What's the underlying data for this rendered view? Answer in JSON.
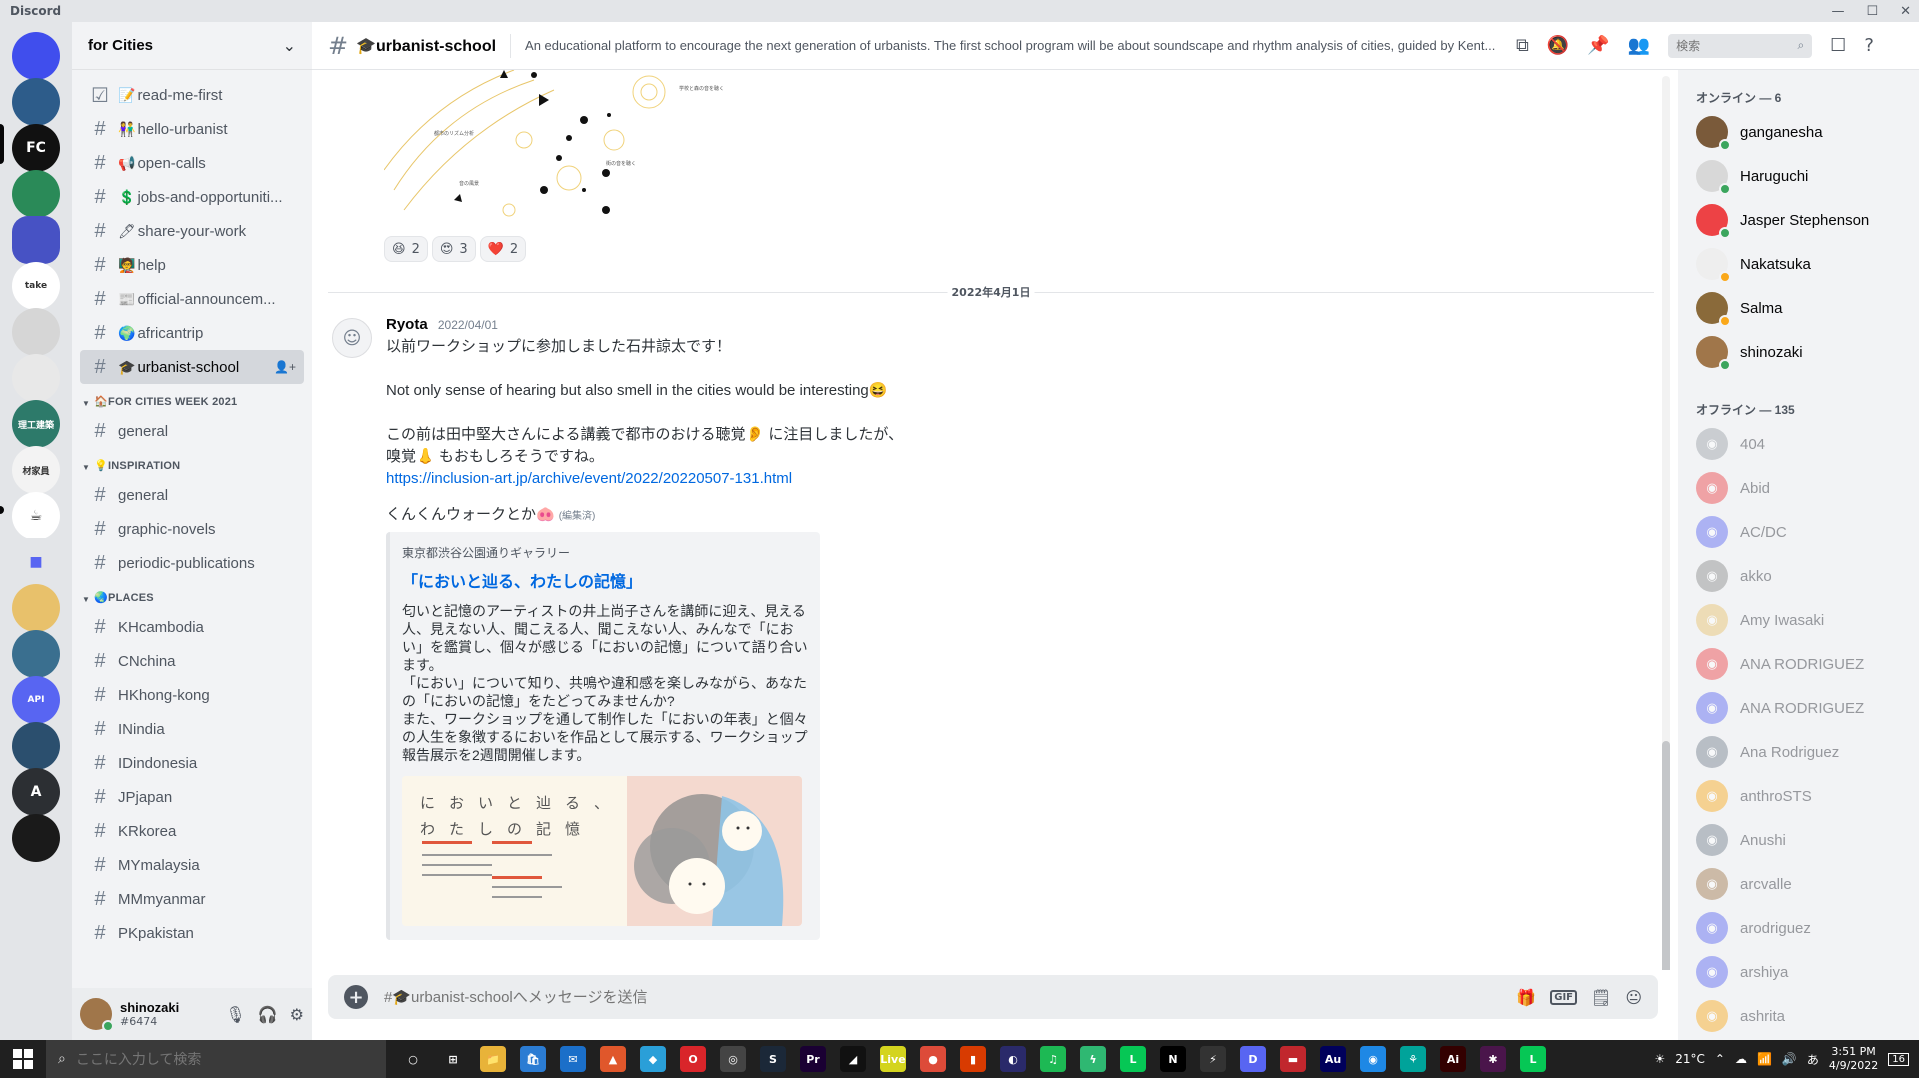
{
  "app": {
    "title": "Discord"
  },
  "servers": [
    {
      "name": "discord-home",
      "color": "#404eed",
      "label": ""
    },
    {
      "name": "server-2",
      "color": "#2d5c8a",
      "label": ""
    },
    {
      "name": "server-fc",
      "color": "#111111",
      "label": "FC"
    },
    {
      "name": "server-4",
      "color": "#2a8a58",
      "label": ""
    },
    {
      "name": "server-school",
      "color": "#4752c4",
      "label": ""
    },
    {
      "name": "server-take",
      "color": "#ffffff",
      "label": "take"
    },
    {
      "name": "server-7",
      "color": "#d6d6d6",
      "label": ""
    },
    {
      "name": "server-8",
      "color": "#e8e8e8",
      "label": ""
    },
    {
      "name": "server-rikou",
      "color": "#2d7a6a",
      "label": "理工建築"
    },
    {
      "name": "server-10",
      "color": "#f3f3f3",
      "label": "材家員"
    },
    {
      "name": "server-coffee",
      "color": "#ffffff",
      "label": "☕"
    },
    {
      "name": "server-folder",
      "color": "#e3e5e8",
      "label": "■"
    },
    {
      "name": "server-13",
      "color": "#e8c16b",
      "label": ""
    },
    {
      "name": "server-14",
      "color": "#3a6f8f",
      "label": ""
    },
    {
      "name": "server-api",
      "color": "#5865f2",
      "label": "API"
    },
    {
      "name": "server-python",
      "color": "#2b4f6e",
      "label": ""
    },
    {
      "name": "server-17",
      "color": "#2c2f33",
      "label": "A"
    },
    {
      "name": "server-obs",
      "color": "#1a1a1a",
      "label": ""
    }
  ],
  "guild": {
    "name": "for Cities"
  },
  "channels_top": [
    {
      "emoji": "📝",
      "label": "read-me-first",
      "kind": "rules"
    },
    {
      "emoji": "👫",
      "label": "hello-urbanist"
    },
    {
      "emoji": "📢",
      "label": "open-calls"
    },
    {
      "emoji": "💲",
      "label": "jobs-and-opportuniti..."
    },
    {
      "emoji": "🖊",
      "label": "share-your-work"
    },
    {
      "emoji": "🧑‍🏫",
      "label": "help"
    },
    {
      "emoji": "📰",
      "label": "official-announcem..."
    },
    {
      "emoji": "🌍",
      "label": "africantrip"
    },
    {
      "emoji": "🎓",
      "label": "urbanist-school",
      "active": true
    }
  ],
  "categories": [
    {
      "emoji": "🏠",
      "label": "FOR CITIES WEEK 2021",
      "channels": [
        {
          "label": "general"
        }
      ]
    },
    {
      "emoji": "💡",
      "label": "INSPIRATION",
      "channels": [
        {
          "label": "general"
        },
        {
          "label": "graphic-novels"
        },
        {
          "label": "periodic-publications"
        }
      ]
    },
    {
      "emoji": "🌏",
      "label": "PLACES",
      "channels": [
        {
          "label": "KHcambodia"
        },
        {
          "label": "CNchina"
        },
        {
          "label": "HKhong-kong"
        },
        {
          "label": "INindia"
        },
        {
          "label": "IDindonesia"
        },
        {
          "label": "JPjapan"
        },
        {
          "label": "KRkorea"
        },
        {
          "label": "MYmalaysia"
        },
        {
          "label": "MMmyanmar"
        },
        {
          "label": "PKpakistan"
        }
      ]
    }
  ],
  "user_panel": {
    "username": "shinozaki",
    "tag": "#6474"
  },
  "chat_header": {
    "channel": "🎓urbanist-school",
    "topic": "An educational platform to encourage the next generation of urbanists. The first school program will be about soundscape and rhythm analysis of cities, guided by Kent...",
    "search_placeholder": "検索"
  },
  "reactions": [
    {
      "emoji": "😆",
      "count": "2"
    },
    {
      "emoji": "😍",
      "count": "3"
    },
    {
      "emoji": "❤️",
      "count": "2"
    }
  ],
  "date_divider": "2022年4月1日",
  "message": {
    "author": "Ryota",
    "timestamp": "2022/04/01",
    "line1": "以前ワークショップに参加しました石井諒太です！",
    "line2": "Not only sense of hearing but also smell in the cities would be interesting😆",
    "line3": "この前は田中堅大さんによる講義で都市のおける聴覚👂 に注目しましたが、",
    "line4": "嗅覚👃 もおもしろそうですね。",
    "link": "https://inclusion-art.jp/archive/event/2022/20220507-131.html",
    "line5": "くんくんウォークとか🐽",
    "edited": "(編集済)"
  },
  "embed": {
    "provider": "東京都渋谷公園通りギャラリー",
    "title": "「においと辿る、わたしの記憶」",
    "description": "匂いと記憶のアーティストの井上尚子さんを講師に迎え、見える人、見えない人、聞こえる人、聞こえない人、みんなで「におい」を鑑賞し、個々が感じる「においの記憶」について語り合います。\n「におい」について知り、共鳴や違和感を楽しみながら、あなたの「においの記憶」をたどってみませんか?\nまた、ワークショップを通して制作した「においの年表」と個々の人生を象徴するにおいを作品として展示する、ワークショップ報告展示を2週間開催します。",
    "image_title": "においと辿る、わたしの記憶"
  },
  "composer": {
    "placeholder": "#🎓urbanist-schoolへメッセージを送信"
  },
  "members": {
    "online_header": "オンライン — 6",
    "online": [
      {
        "name": "ganganesha",
        "color": "#7a5a3a",
        "status": "#3ba55d"
      },
      {
        "name": "Haruguchi",
        "color": "#d8d8d8",
        "status": "#3ba55d"
      },
      {
        "name": "Jasper Stephenson",
        "color": "#ed4245",
        "status": "#3ba55d"
      },
      {
        "name": "Nakatsuka",
        "color": "#eeeeee",
        "status": "#faa81a"
      },
      {
        "name": "Salma",
        "color": "#8a6a3a",
        "status": "#faa81a"
      },
      {
        "name": "shinozaki",
        "color": "#a0764a",
        "status": "#3ba55d"
      }
    ],
    "offline_header": "オフライン — 135",
    "offline": [
      {
        "name": "404",
        "color": "#9aa0a6"
      },
      {
        "name": "Abid",
        "color": "#ed4245"
      },
      {
        "name": "AC/DC",
        "color": "#5865f2"
      },
      {
        "name": "akko",
        "color": "#8a8a8a"
      },
      {
        "name": "Amy Iwasaki",
        "color": "#e8c16b"
      },
      {
        "name": "ANA RODRIGUEZ",
        "color": "#ed4245"
      },
      {
        "name": "ANA RODRIGUEZ",
        "color": "#5865f2"
      },
      {
        "name": "Ana Rodriguez",
        "color": "#747f8d"
      },
      {
        "name": "anthroSTS",
        "color": "#faa81a"
      },
      {
        "name": "Anushi",
        "color": "#747f8d"
      },
      {
        "name": "arcvalle",
        "color": "#a0764a"
      },
      {
        "name": "arodriguez",
        "color": "#5865f2"
      },
      {
        "name": "arshiya",
        "color": "#5865f2"
      },
      {
        "name": "ashrita",
        "color": "#faa81a"
      }
    ]
  },
  "taskbar": {
    "search_placeholder": "ここに入力して検索",
    "apps": [
      {
        "label": "○",
        "color": "transparent"
      },
      {
        "label": "⊞",
        "color": "transparent"
      },
      {
        "label": "📁",
        "color": "#e8b339"
      },
      {
        "label": "🛍",
        "color": "#2b7cd3"
      },
      {
        "label": "✉",
        "color": "#1b6fc9"
      },
      {
        "label": "▲",
        "color": "#e0572b"
      },
      {
        "label": "◆",
        "color": "#2a9fd8"
      },
      {
        "label": "O",
        "color": "#d9252a"
      },
      {
        "label": "◎",
        "color": "#444"
      },
      {
        "label": "S",
        "color": "#1b2838"
      },
      {
        "label": "Pr",
        "color": "#1a0033"
      },
      {
        "label": "◢",
        "color": "#111"
      },
      {
        "label": "Live",
        "color": "#d4d41e"
      },
      {
        "label": "●",
        "color": "#dd4b39"
      },
      {
        "label": "▮",
        "color": "#d83b01"
      },
      {
        "label": "◐",
        "color": "#2a2a6a"
      },
      {
        "label": "♫",
        "color": "#1db954"
      },
      {
        "label": "ϟ",
        "color": "#2fb872"
      },
      {
        "label": "L",
        "color": "#06c755"
      },
      {
        "label": "N",
        "color": "#000"
      },
      {
        "label": "⚡",
        "color": "#333"
      },
      {
        "label": "D",
        "color": "#5865f2"
      },
      {
        "label": "▬",
        "color": "#c1272d"
      },
      {
        "label": "Au",
        "color": "#00005b"
      },
      {
        "label": "◉",
        "color": "#1e88e5"
      },
      {
        "label": "⚘",
        "color": "#00a39a"
      },
      {
        "label": "Ai",
        "color": "#330000"
      },
      {
        "label": "✱",
        "color": "#4a154b"
      },
      {
        "label": "L",
        "color": "#06c755"
      }
    ],
    "weather": "21°C",
    "time": "3:51 PM",
    "date": "4/9/2022",
    "ime": "あ",
    "notifications": "16"
  }
}
